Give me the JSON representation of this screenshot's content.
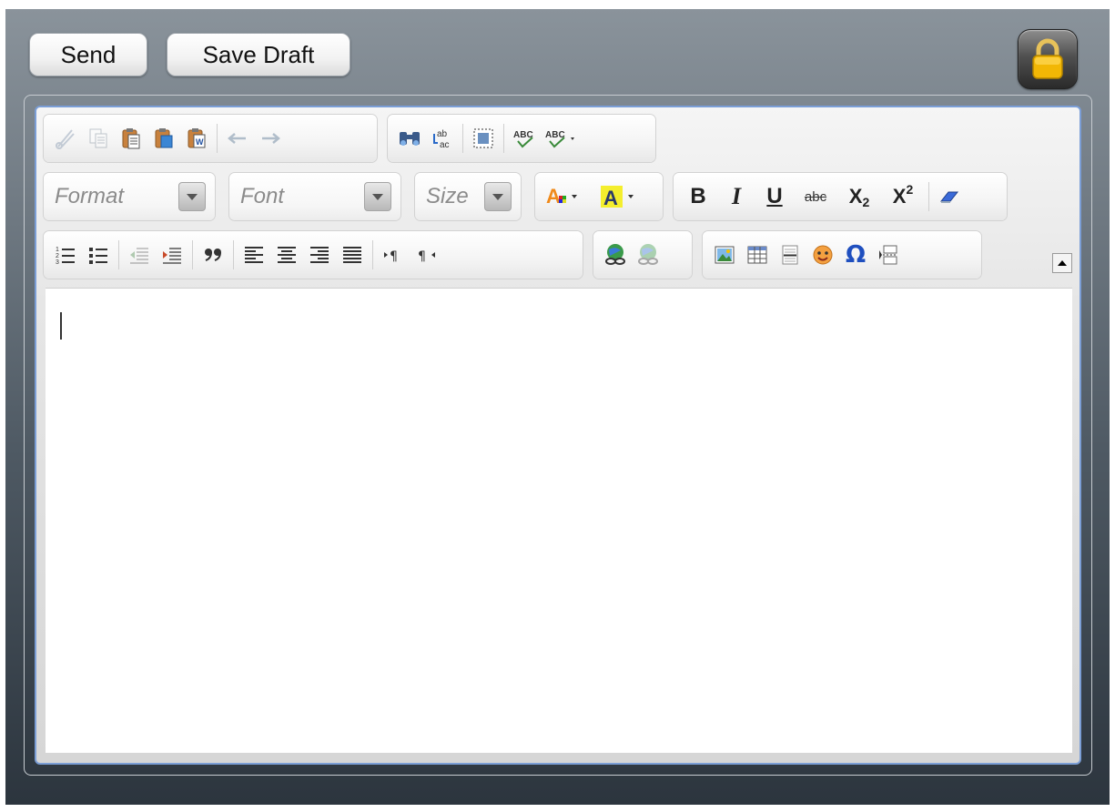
{
  "actions": {
    "send_label": "Send",
    "save_draft_label": "Save Draft"
  },
  "icons": {
    "lock": "lock-icon"
  },
  "toolbar": {
    "row1": {
      "clipboard": [
        "cut-icon",
        "copy-icon",
        "paste-icon",
        "paste-text-icon",
        "paste-word-icon"
      ],
      "history": [
        "undo-icon",
        "redo-icon"
      ],
      "find": [
        "find-icon",
        "replace-icon"
      ],
      "select": [
        "select-all-icon"
      ],
      "spell": [
        "spellcheck-icon",
        "spellcheck-as-you-type-icon"
      ]
    },
    "combos": {
      "format": "Format",
      "font": "Font",
      "size": "Size"
    },
    "basic_styles": {
      "bold": "B",
      "italic": "I",
      "underline": "U",
      "strike": "abc",
      "subscript_base": "X",
      "subscript_mark": "2",
      "superscript_base": "X",
      "superscript_mark": "2"
    },
    "colors": {
      "text_color_glyph": "A",
      "bg_color_glyph": "A",
      "highlight": "#f4ee2d"
    }
  },
  "editor": {
    "content": ""
  },
  "colors": {
    "panel_top": "#8a939b",
    "panel_bottom": "#2c353e",
    "editor_border": "#7b9ed6",
    "lock_gold": "#f2b705"
  }
}
